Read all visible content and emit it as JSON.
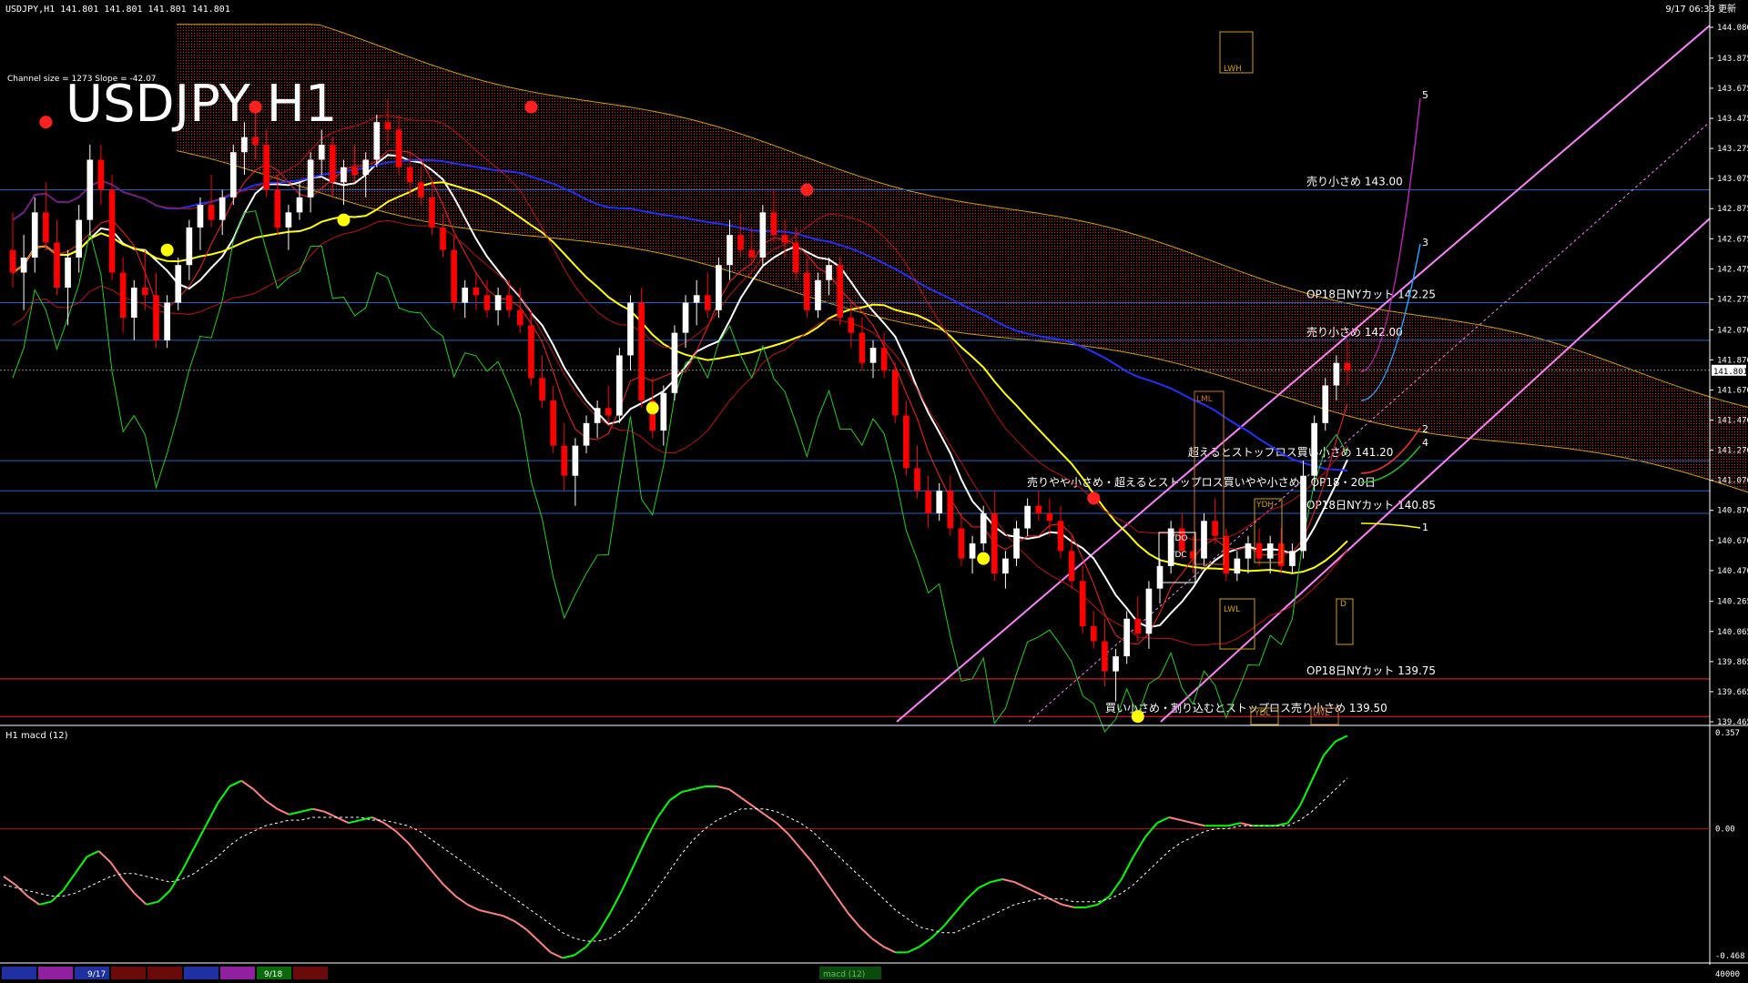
{
  "header": {
    "info": "USDJPY,H1  141.801 141.801 141.801 141.801",
    "datetime": "9/17 06:33 更新",
    "channel_info": "Channel size = 1273  Slope = -42.07",
    "big_title": "USDJPY H1"
  },
  "macd_panel": {
    "label": "H1  macd (12)",
    "scale": [
      "0.357",
      "0.00",
      "-0.468"
    ]
  },
  "bottom_bar": {
    "date_labels": [
      "9/17",
      "9/18"
    ],
    "center_label": "macd (12)",
    "right_value": "40000"
  },
  "colors": {
    "background": "#000000",
    "bull_candle": "#ffffff",
    "bear_candle": "#ff0000",
    "kumo": "#ff2020",
    "price_tag": "#ffffff",
    "fib_channel": "#ff80ff",
    "macd_up": "#00ff00",
    "macd_down": "#ff8080",
    "level_blue": "#1e64c8",
    "level_red": "#ff2020",
    "ma_yellow": "#ffff00",
    "ma_blue": "#2030ff"
  },
  "chart_data": {
    "type": "candlestick",
    "symbol": "USDJPY",
    "timeframe": "H1",
    "last_price": "141.801",
    "y_axis": {
      "ylim": [
        139.465,
        144.08
      ],
      "ticks": [
        "144.080",
        "143.875",
        "143.675",
        "143.475",
        "143.275",
        "143.075",
        "142.875",
        "142.675",
        "142.475",
        "142.275",
        "142.070",
        "141.870",
        "141.670",
        "141.470",
        "141.270",
        "141.070",
        "140.870",
        "140.670",
        "140.470",
        "140.265",
        "140.065",
        "139.865",
        "139.665",
        "139.465"
      ]
    },
    "levels": [
      {
        "price": 143.0,
        "label": "売り小さめ 143.00",
        "color": "blue"
      },
      {
        "price": 142.25,
        "label": "OP18日NYカット 142.25",
        "color": "blue"
      },
      {
        "price": 142.0,
        "label": "売り小さめ 142.00",
        "color": "blue"
      },
      {
        "price": 141.2,
        "label": "超えるとストップロス買い小さめ 141.20",
        "color": "blue"
      },
      {
        "price": 141.0,
        "label": "売りやや小さめ・超えるとストップロス買いやや小さめ、OP18・20日",
        "color": "blue"
      },
      {
        "price": 140.85,
        "label": "OP18日NYカット 140.85",
        "color": "blue"
      },
      {
        "price": 139.75,
        "label": "OP18日NYカット 139.75",
        "color": "red"
      },
      {
        "price": 139.5,
        "label": "買い小さめ・割り込むとストップロス売り小さめ 139.50",
        "color": "red"
      }
    ],
    "box_labels": [
      "LWH",
      "LML",
      "YDH",
      "YDO",
      "YDC",
      "LWL",
      "YDL",
      "LWL",
      "D"
    ],
    "wave_labels": [
      "5",
      "3",
      "2",
      "4",
      "1"
    ],
    "candles": [
      [
        142.6,
        142.85,
        142.35,
        142.45
      ],
      [
        142.45,
        142.7,
        142.2,
        142.55
      ],
      [
        142.55,
        142.95,
        142.45,
        142.85
      ],
      [
        142.85,
        143.05,
        142.6,
        142.65
      ],
      [
        142.65,
        142.8,
        142.3,
        142.35
      ],
      [
        142.35,
        142.6,
        142.1,
        142.55
      ],
      [
        142.55,
        142.9,
        142.45,
        142.8
      ],
      [
        142.8,
        143.3,
        142.7,
        143.2
      ],
      [
        143.2,
        143.3,
        142.9,
        143.0
      ],
      [
        143.0,
        143.1,
        142.4,
        142.45
      ],
      [
        142.45,
        142.55,
        142.05,
        142.15
      ],
      [
        142.15,
        142.4,
        142.0,
        142.35
      ],
      [
        142.35,
        142.6,
        142.2,
        142.3
      ],
      [
        142.3,
        142.45,
        141.95,
        142.0
      ],
      [
        142.0,
        142.3,
        141.95,
        142.25
      ],
      [
        142.25,
        142.55,
        142.2,
        142.5
      ],
      [
        142.5,
        142.8,
        142.4,
        142.75
      ],
      [
        142.75,
        142.95,
        142.6,
        142.9
      ],
      [
        142.9,
        143.1,
        142.75,
        142.8
      ],
      [
        142.8,
        143.0,
        142.7,
        142.95
      ],
      [
        142.95,
        143.3,
        142.9,
        143.25
      ],
      [
        143.25,
        143.45,
        143.1,
        143.35
      ],
      [
        143.35,
        143.55,
        143.2,
        143.3
      ],
      [
        143.3,
        143.4,
        142.95,
        143.0
      ],
      [
        143.0,
        143.1,
        142.7,
        142.75
      ],
      [
        142.75,
        142.9,
        142.6,
        142.85
      ],
      [
        142.85,
        143.05,
        142.8,
        142.95
      ],
      [
        142.95,
        143.25,
        142.85,
        143.2
      ],
      [
        143.2,
        143.4,
        143.1,
        143.3
      ],
      [
        143.3,
        143.35,
        142.95,
        143.05
      ],
      [
        143.05,
        143.2,
        142.9,
        143.15
      ],
      [
        143.15,
        143.3,
        143.05,
        143.1
      ],
      [
        143.1,
        143.25,
        142.95,
        143.2
      ],
      [
        143.2,
        143.5,
        143.15,
        143.45
      ],
      [
        143.45,
        143.6,
        143.3,
        143.4
      ],
      [
        143.4,
        143.5,
        143.1,
        143.15
      ],
      [
        143.15,
        143.25,
        142.95,
        143.05
      ],
      [
        143.05,
        143.15,
        142.9,
        142.95
      ],
      [
        142.95,
        143.05,
        142.7,
        142.75
      ],
      [
        142.75,
        142.85,
        142.55,
        142.6
      ],
      [
        142.6,
        142.7,
        142.2,
        142.25
      ],
      [
        142.25,
        142.4,
        142.15,
        142.35
      ],
      [
        142.35,
        142.45,
        142.2,
        142.3
      ],
      [
        142.3,
        142.4,
        142.15,
        142.2
      ],
      [
        142.2,
        142.35,
        142.1,
        142.3
      ],
      [
        142.3,
        142.4,
        142.15,
        142.2
      ],
      [
        142.2,
        142.35,
        142.05,
        142.1
      ],
      [
        142.1,
        142.2,
        141.7,
        141.75
      ],
      [
        141.75,
        141.9,
        141.55,
        141.6
      ],
      [
        141.6,
        141.7,
        141.25,
        141.3
      ],
      [
        141.3,
        141.45,
        141.0,
        141.1
      ],
      [
        141.1,
        141.35,
        140.9,
        141.3
      ],
      [
        141.3,
        141.5,
        141.25,
        141.45
      ],
      [
        141.45,
        141.6,
        141.35,
        141.55
      ],
      [
        141.55,
        141.7,
        141.45,
        141.5
      ],
      [
        141.5,
        141.95,
        141.45,
        141.9
      ],
      [
        141.9,
        142.3,
        141.8,
        142.25
      ],
      [
        142.25,
        142.35,
        141.55,
        141.6
      ],
      [
        141.6,
        141.75,
        141.35,
        141.4
      ],
      [
        141.4,
        141.7,
        141.3,
        141.65
      ],
      [
        141.65,
        142.1,
        141.6,
        142.05
      ],
      [
        142.05,
        142.3,
        141.95,
        142.25
      ],
      [
        142.25,
        142.4,
        142.1,
        142.3
      ],
      [
        142.3,
        142.45,
        142.15,
        142.2
      ],
      [
        142.2,
        142.55,
        142.15,
        142.5
      ],
      [
        142.5,
        142.8,
        142.4,
        142.7
      ],
      [
        142.7,
        142.85,
        142.55,
        142.6
      ],
      [
        142.6,
        142.75,
        142.5,
        142.55
      ],
      [
        142.55,
        142.9,
        142.5,
        142.85
      ],
      [
        142.85,
        143.0,
        142.65,
        142.7
      ],
      [
        142.7,
        142.8,
        142.55,
        142.65
      ],
      [
        142.65,
        142.75,
        142.4,
        142.45
      ],
      [
        142.45,
        142.55,
        142.15,
        142.2
      ],
      [
        142.2,
        142.45,
        142.15,
        142.4
      ],
      [
        142.4,
        142.55,
        142.3,
        142.5
      ],
      [
        142.5,
        142.55,
        142.1,
        142.15
      ],
      [
        142.15,
        142.25,
        141.95,
        142.05
      ],
      [
        142.05,
        142.15,
        141.8,
        141.85
      ],
      [
        141.85,
        142.0,
        141.75,
        141.95
      ],
      [
        141.95,
        142.05,
        141.75,
        141.8
      ],
      [
        141.8,
        141.85,
        141.45,
        141.5
      ],
      [
        141.5,
        141.6,
        141.1,
        141.15
      ],
      [
        141.15,
        141.3,
        140.95,
        141.0
      ],
      [
        141.0,
        141.1,
        140.75,
        140.85
      ],
      [
        140.85,
        141.05,
        140.8,
        141.0
      ],
      [
        141.0,
        141.1,
        140.7,
        140.75
      ],
      [
        140.75,
        140.85,
        140.5,
        140.55
      ],
      [
        140.55,
        140.7,
        140.45,
        140.65
      ],
      [
        140.65,
        140.9,
        140.6,
        140.85
      ],
      [
        140.85,
        141.0,
        140.4,
        140.45
      ],
      [
        140.45,
        140.6,
        140.35,
        140.55
      ],
      [
        140.55,
        140.8,
        140.5,
        140.75
      ],
      [
        140.75,
        140.95,
        140.7,
        140.9
      ],
      [
        140.9,
        141.0,
        140.8,
        140.85
      ],
      [
        140.85,
        140.95,
        140.7,
        140.8
      ],
      [
        140.8,
        140.9,
        140.55,
        140.6
      ],
      [
        140.6,
        140.7,
        140.35,
        140.4
      ],
      [
        140.4,
        140.5,
        140.05,
        140.1
      ],
      [
        140.1,
        140.2,
        139.95,
        140.0
      ],
      [
        140.0,
        140.15,
        139.7,
        139.8
      ],
      [
        139.8,
        139.95,
        139.6,
        139.9
      ],
      [
        139.9,
        140.2,
        139.85,
        140.15
      ],
      [
        140.15,
        140.3,
        140.0,
        140.05
      ],
      [
        140.05,
        140.4,
        139.95,
        140.35
      ],
      [
        140.35,
        140.55,
        140.25,
        140.5
      ],
      [
        140.5,
        140.8,
        140.45,
        140.75
      ],
      [
        140.75,
        140.85,
        140.55,
        140.6
      ],
      [
        140.6,
        140.7,
        140.45,
        140.55
      ],
      [
        140.55,
        140.85,
        140.5,
        140.8
      ],
      [
        140.8,
        140.95,
        140.65,
        140.7
      ],
      [
        140.7,
        140.75,
        140.4,
        140.45
      ],
      [
        140.45,
        140.6,
        140.4,
        140.55
      ],
      [
        140.55,
        140.7,
        140.45,
        140.65
      ],
      [
        140.65,
        140.75,
        140.5,
        140.55
      ],
      [
        140.55,
        140.7,
        140.45,
        140.65
      ],
      [
        140.65,
        140.75,
        140.45,
        140.5
      ],
      [
        140.5,
        140.65,
        140.45,
        140.6
      ],
      [
        140.6,
        141.2,
        140.55,
        141.1
      ],
      [
        141.1,
        141.5,
        141.0,
        141.45
      ],
      [
        141.45,
        141.75,
        141.4,
        141.7
      ],
      [
        141.7,
        141.9,
        141.6,
        141.85
      ],
      [
        141.85,
        142.0,
        141.7,
        141.8
      ]
    ],
    "macd": {
      "range": [
        -0.468,
        0.357
      ],
      "main": [
        -0.17,
        -0.2,
        -0.24,
        -0.27,
        -0.26,
        -0.22,
        -0.16,
        -0.1,
        -0.08,
        -0.12,
        -0.18,
        -0.23,
        -0.27,
        -0.26,
        -0.22,
        -0.15,
        -0.07,
        0.01,
        0.09,
        0.15,
        0.17,
        0.14,
        0.1,
        0.07,
        0.05,
        0.06,
        0.07,
        0.06,
        0.04,
        0.02,
        0.03,
        0.04,
        0.02,
        -0.01,
        -0.05,
        -0.1,
        -0.15,
        -0.2,
        -0.24,
        -0.27,
        -0.29,
        -0.3,
        -0.31,
        -0.33,
        -0.36,
        -0.4,
        -0.44,
        -0.46,
        -0.45,
        -0.42,
        -0.37,
        -0.3,
        -0.22,
        -0.13,
        -0.04,
        0.04,
        0.1,
        0.13,
        0.14,
        0.15,
        0.15,
        0.14,
        0.11,
        0.08,
        0.05,
        0.02,
        -0.02,
        -0.07,
        -0.12,
        -0.18,
        -0.24,
        -0.3,
        -0.35,
        -0.39,
        -0.42,
        -0.44,
        -0.44,
        -0.42,
        -0.39,
        -0.35,
        -0.3,
        -0.25,
        -0.21,
        -0.19,
        -0.18,
        -0.19,
        -0.21,
        -0.23,
        -0.25,
        -0.27,
        -0.28,
        -0.28,
        -0.27,
        -0.24,
        -0.18,
        -0.1,
        -0.03,
        0.02,
        0.04,
        0.03,
        0.02,
        0.01,
        0.01,
        0.01,
        0.02,
        0.01,
        0.01,
        0.01,
        0.02,
        0.08,
        0.17,
        0.26,
        0.31,
        0.33
      ],
      "signal": [
        -0.2,
        -0.21,
        -0.22,
        -0.23,
        -0.24,
        -0.24,
        -0.23,
        -0.21,
        -0.19,
        -0.17,
        -0.16,
        -0.16,
        -0.17,
        -0.18,
        -0.19,
        -0.18,
        -0.16,
        -0.13,
        -0.1,
        -0.06,
        -0.03,
        -0.01,
        0.01,
        0.02,
        0.03,
        0.03,
        0.04,
        0.04,
        0.04,
        0.04,
        0.04,
        0.03,
        0.03,
        0.02,
        0.01,
        -0.01,
        -0.04,
        -0.07,
        -0.1,
        -0.13,
        -0.16,
        -0.19,
        -0.22,
        -0.25,
        -0.28,
        -0.31,
        -0.34,
        -0.37,
        -0.39,
        -0.4,
        -0.4,
        -0.39,
        -0.36,
        -0.32,
        -0.27,
        -0.21,
        -0.15,
        -0.09,
        -0.04,
        0.0,
        0.03,
        0.05,
        0.07,
        0.07,
        0.07,
        0.06,
        0.04,
        0.02,
        -0.01,
        -0.05,
        -0.09,
        -0.13,
        -0.17,
        -0.21,
        -0.25,
        -0.29,
        -0.32,
        -0.35,
        -0.36,
        -0.37,
        -0.37,
        -0.35,
        -0.33,
        -0.31,
        -0.29,
        -0.27,
        -0.26,
        -0.25,
        -0.25,
        -0.25,
        -0.26,
        -0.26,
        -0.26,
        -0.25,
        -0.23,
        -0.2,
        -0.16,
        -0.12,
        -0.08,
        -0.05,
        -0.03,
        -0.01,
        0.0,
        0.0,
        0.01,
        0.01,
        0.01,
        0.01,
        0.01,
        0.03,
        0.06,
        0.1,
        0.14,
        0.18
      ]
    }
  }
}
